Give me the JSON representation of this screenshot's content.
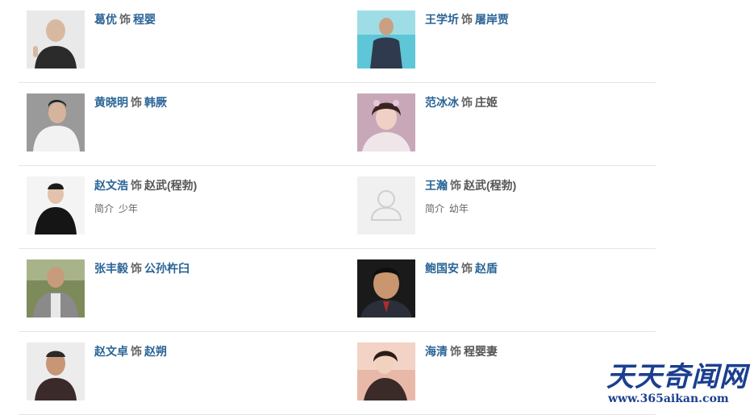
{
  "as_word": "饰",
  "intro_label": "简介",
  "cast": [
    {
      "actor": "葛优",
      "role": "程婴",
      "role_linked": true,
      "intro": "",
      "photo": "photo-portrait-icon"
    },
    {
      "actor": "王学圻",
      "role": "屠岸贾",
      "role_linked": true,
      "intro": "",
      "photo": "photo-portrait-icon"
    },
    {
      "actor": "黄晓明",
      "role": "韩厥",
      "role_linked": true,
      "intro": "",
      "photo": "photo-portrait-icon"
    },
    {
      "actor": "范冰冰",
      "role": "庄姬",
      "role_linked": false,
      "intro": "",
      "photo": "photo-portrait-icon"
    },
    {
      "actor": "赵文浩",
      "role": "赵武(程勃)",
      "role_linked": false,
      "intro": "少年",
      "photo": "photo-portrait-icon"
    },
    {
      "actor": "王瀚",
      "role": "赵武(程勃)",
      "role_linked": false,
      "intro": "幼年",
      "photo": "default-user-icon"
    },
    {
      "actor": "张丰毅",
      "role": "公孙杵臼",
      "role_linked": true,
      "intro": "",
      "photo": "photo-portrait-icon"
    },
    {
      "actor": "鲍国安",
      "role": "赵盾",
      "role_linked": true,
      "intro": "",
      "photo": "photo-portrait-icon"
    },
    {
      "actor": "赵文卓",
      "role": "赵朔",
      "role_linked": true,
      "intro": "",
      "photo": "photo-portrait-icon"
    },
    {
      "actor": "海清",
      "role": "程婴妻",
      "role_linked": false,
      "intro": "",
      "photo": "photo-portrait-icon"
    }
  ],
  "watermark": {
    "title": "天天奇闻网",
    "url": "www.365aikan.com"
  },
  "colors": {
    "link": "#2a6496",
    "text": "#555555",
    "divider": "#e5e5e5",
    "watermark": "#1b3f8f"
  }
}
